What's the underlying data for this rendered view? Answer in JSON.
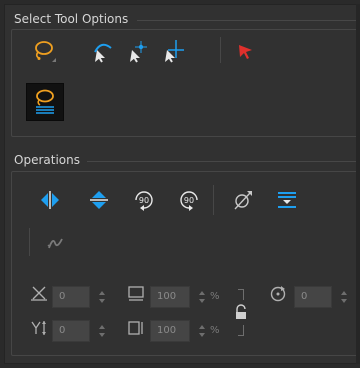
{
  "select_tool_options": {
    "title": "Select Tool Options",
    "tools": [
      {
        "name": "lasso-icon",
        "color": "#f0a020"
      },
      {
        "name": "select-contour-icon",
        "color": "#9fc8f0"
      },
      {
        "name": "select-point-icon",
        "color": "#9fc8f0"
      },
      {
        "name": "select-centerline-icon",
        "color": "#9fc8f0"
      },
      {
        "name": "red-arrow-select-icon",
        "color": "#e0302c"
      },
      {
        "name": "lasso-selected-icon",
        "color": "#f0a020"
      }
    ]
  },
  "operations": {
    "title": "Operations",
    "buttons": [
      {
        "name": "flip-horizontal-icon"
      },
      {
        "name": "flip-vertical-icon"
      },
      {
        "name": "rotate-90-cw-icon",
        "label": "90"
      },
      {
        "name": "rotate-90-ccw-icon",
        "label": "90"
      },
      {
        "name": "no-tint-icon"
      },
      {
        "name": "distribute-icon"
      },
      {
        "name": "smooth-icon"
      }
    ],
    "fields": {
      "x": {
        "value": "0"
      },
      "y": {
        "value": "0"
      },
      "width": {
        "value": "100",
        "unit": "%"
      },
      "height": {
        "value": "100",
        "unit": "%"
      },
      "angle": {
        "value": "0"
      }
    }
  },
  "colors": {
    "accent_blue": "#1e9ff0",
    "accent_orange": "#f0a020",
    "accent_red": "#e0302c"
  }
}
